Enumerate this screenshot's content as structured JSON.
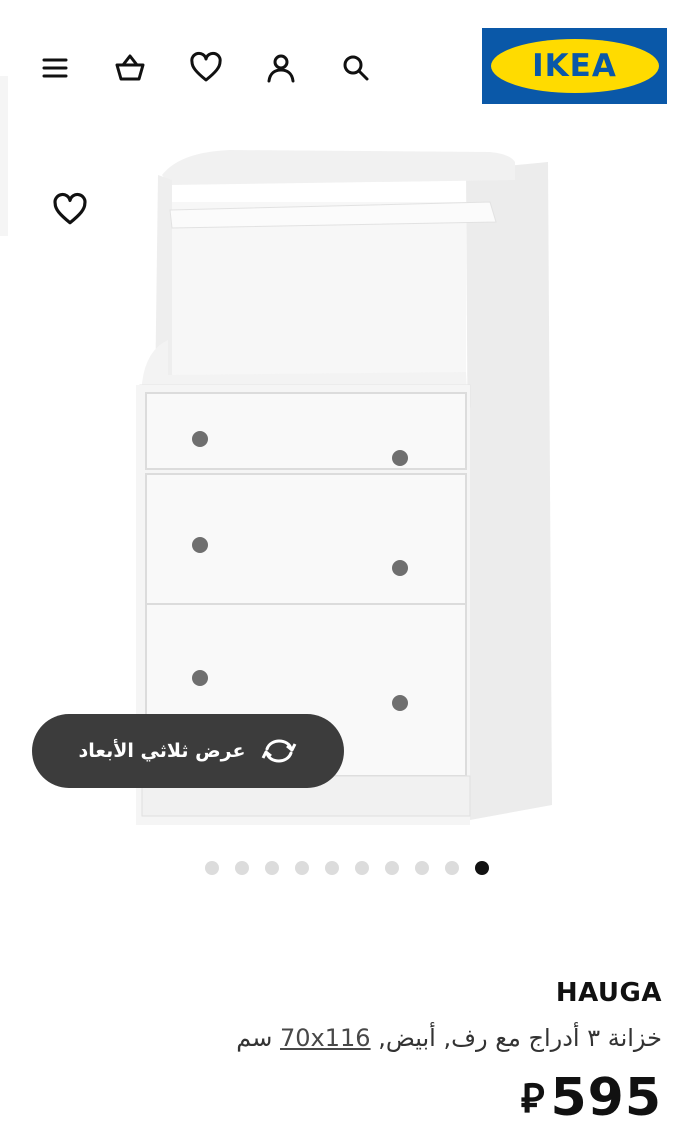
{
  "header": {
    "logo_text": "IKEA",
    "icons": [
      "menu-icon",
      "basket-icon",
      "heart-icon",
      "user-icon",
      "search-icon"
    ]
  },
  "product": {
    "favorite_icon": "heart-outline-icon",
    "view3d_label": "عرض ثلاثي الأبعاد",
    "view3d_icon": "rotate-icon",
    "carousel": {
      "count": 10,
      "active_index": 9
    },
    "name": "HAUGA",
    "description": "خزانة ٣ أدراج مع رف, أبيض,",
    "measure": "70x116",
    "measure_unit": "سم",
    "price": "595",
    "currency": "⃁"
  },
  "colors": {
    "brand_blue": "#0a58a8",
    "brand_yellow": "#ffdb00",
    "pill_bg": "#3c3c3c"
  }
}
